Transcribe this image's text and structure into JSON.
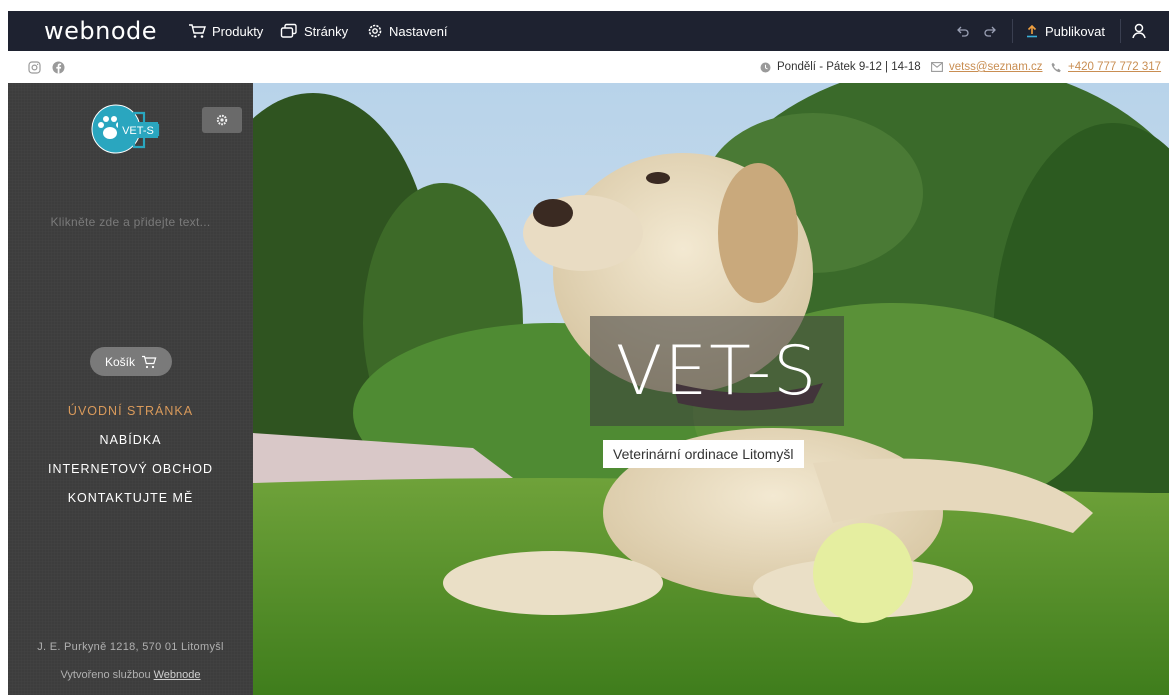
{
  "editor": {
    "logo": "webnode",
    "nav": {
      "products": "Produkty",
      "pages": "Stránky",
      "settings": "Nastavení"
    },
    "publish": "Publikovat"
  },
  "infobar": {
    "hours": "Pondělí - Pátek 9-12 | 14-18",
    "email": "vetss@seznam.cz",
    "phone": "+420 777 772 317"
  },
  "sidebar": {
    "logo_text": "VET-S",
    "placeholder": "Klikněte zde a přidejte text...",
    "cart": "Košík",
    "menu": [
      {
        "label": "ÚVODNÍ STRÁNKA",
        "active": true
      },
      {
        "label": "NABÍDKA",
        "active": false
      },
      {
        "label": "INTERNETOVÝ OBCHOD",
        "active": false
      },
      {
        "label": "KONTAKTUJTE MĚ",
        "active": false
      }
    ],
    "address": "J. E. Purkyně 1218, 570 01 Litomyšl",
    "made_by_prefix": "Vytvořeno službou",
    "made_by_link": "Webnode"
  },
  "hero": {
    "title": "VET-S",
    "subtitle": "Veterinární ordinace Litomyšl"
  },
  "colors": {
    "topbar": "#1e2230",
    "accent": "#d99a5b",
    "link": "#c98e52",
    "sidebar": "#3d3d3d",
    "logo_teal": "#2aa6bf"
  },
  "icons": [
    "cart-icon",
    "pages-icon",
    "gear-icon",
    "undo-icon",
    "redo-icon",
    "upload-icon",
    "user-icon",
    "instagram-icon",
    "facebook-icon",
    "clock-icon",
    "mail-icon",
    "phone-icon"
  ]
}
